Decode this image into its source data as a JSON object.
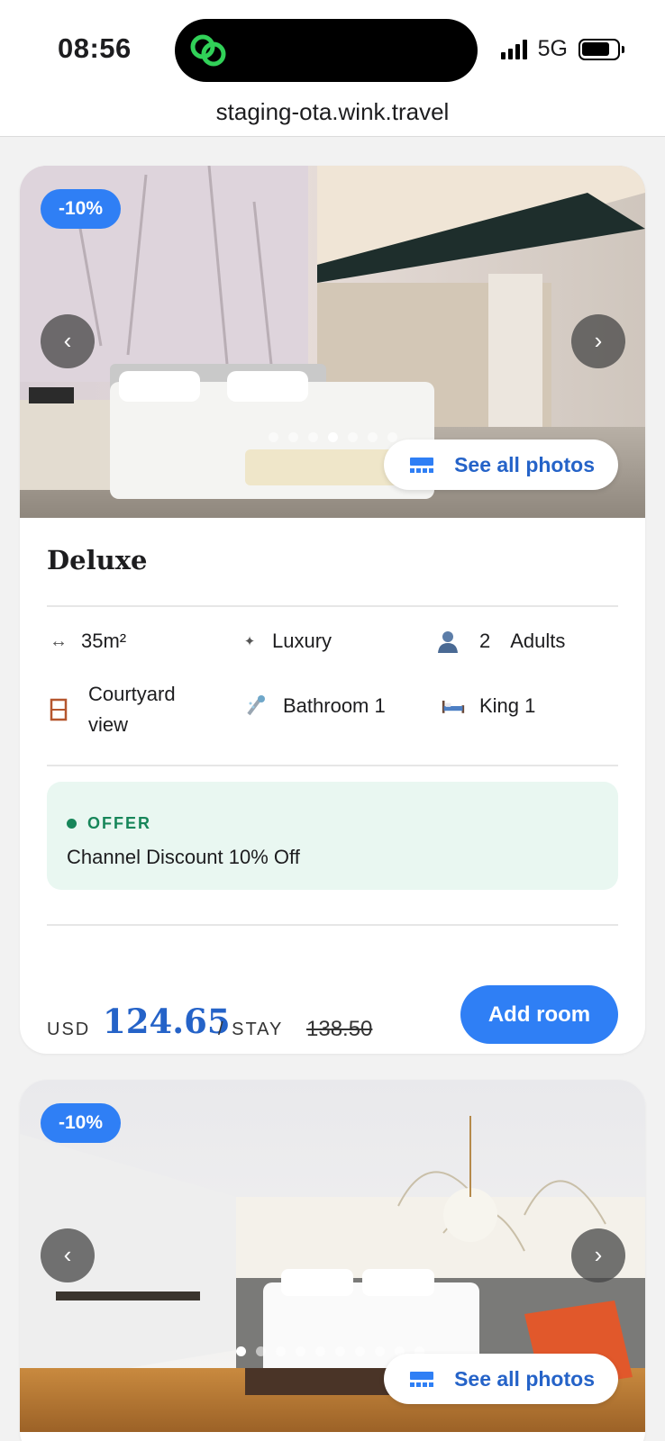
{
  "status_bar": {
    "time": "08:56",
    "network": "5G"
  },
  "browser": {
    "url": "staging-ota.wink.travel"
  },
  "rooms": [
    {
      "discount_badge": "-10%",
      "prev_arrow": "‹",
      "next_arrow": "›",
      "photo_count": 7,
      "active_photo": 3,
      "see_all_label": "See all photos",
      "name": "Deluxe",
      "features": {
        "size": "35m²",
        "category": "Luxury",
        "guests_count": "2",
        "guests_label": "Adults",
        "view_line1": "Courtyard",
        "view_line2": "view",
        "bathroom": "Bathroom 1",
        "bed": "King 1"
      },
      "offer": {
        "tag": "OFFER",
        "text": "Channel Discount 10% Off"
      },
      "price": {
        "currency": "USD",
        "amount": "124.65",
        "per": "/ STAY",
        "original": "138.50"
      },
      "add_button": "Add room"
    },
    {
      "discount_badge": "-10%",
      "prev_arrow": "‹",
      "next_arrow": "›",
      "photo_count": 10,
      "active_photo": 0,
      "see_all_label": "See all photos"
    }
  ],
  "colors": {
    "accent": "#2f7ff5",
    "price_blue": "#2563c8",
    "offer_green": "#17865a",
    "offer_bg": "#e9f7f1"
  }
}
